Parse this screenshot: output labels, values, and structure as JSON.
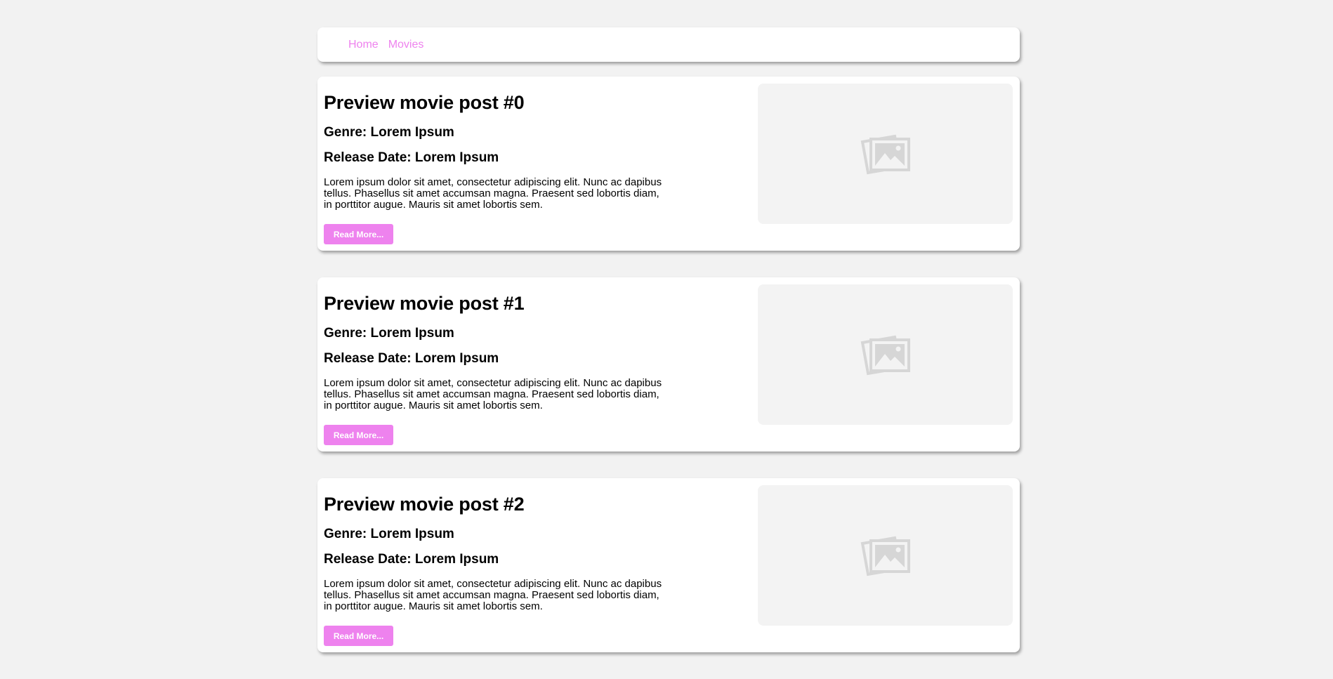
{
  "nav": {
    "links": [
      {
        "label": "Home"
      },
      {
        "label": "Movies"
      }
    ]
  },
  "posts": [
    {
      "title": "Preview movie post #0",
      "genre": "Genre: Lorem Ipsum",
      "release_date": "Release Date: Lorem Ipsum",
      "body": "Lorem ipsum dolor sit amet, consectetur adipiscing elit. Nunc ac dapibus tellus. Phasellus sit amet accumsan magna. Praesent sed lobortis diam, in porttitor augue. Mauris sit amet lobortis sem.",
      "button_label": "Read More...",
      "image_icon": "image-placeholder-icon"
    },
    {
      "title": "Preview movie post #1",
      "genre": "Genre: Lorem Ipsum",
      "release_date": "Release Date: Lorem Ipsum",
      "body": "Lorem ipsum dolor sit amet, consectetur adipiscing elit. Nunc ac dapibus tellus. Phasellus sit amet accumsan magna. Praesent sed lobortis diam, in porttitor augue. Mauris sit amet lobortis sem.",
      "button_label": "Read More...",
      "image_icon": "image-placeholder-icon"
    },
    {
      "title": "Preview movie post #2",
      "genre": "Genre: Lorem Ipsum",
      "release_date": "Release Date: Lorem Ipsum",
      "body": "Lorem ipsum dolor sit amet, consectetur adipiscing elit. Nunc ac dapibus tellus. Phasellus sit amet accumsan magna. Praesent sed lobortis diam, in porttitor augue. Mauris sit amet lobortis sem.",
      "button_label": "Read More...",
      "image_icon": "image-placeholder-icon"
    }
  ],
  "colors": {
    "accent": "#ee82ee",
    "page_background": "#f2f2f2",
    "card_background": "#ffffff",
    "placeholder_background": "#f3f3f3",
    "placeholder_icon": "#d6d6d6"
  }
}
